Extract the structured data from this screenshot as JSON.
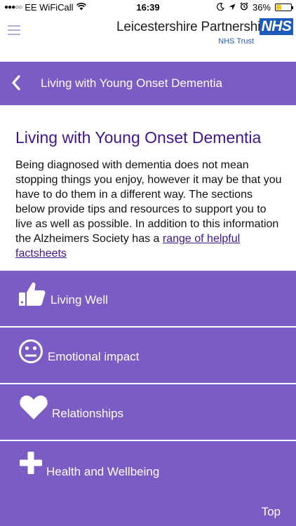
{
  "status_bar": {
    "carrier": "EE WiFiCall",
    "time": "16:39",
    "battery": "36%",
    "battery_level": 0.36
  },
  "header": {
    "org_name": "Leicestershire Partnership",
    "nhs_logo": "NHS",
    "org_sub": "NHS Trust",
    "menu_icon": "hamburger-icon"
  },
  "title_bar": {
    "back_icon": "chevron-left-icon",
    "title": "Living with Young Onset Dementia"
  },
  "content": {
    "heading": "Living with Young Onset Dementia",
    "intro": "Being diagnosed with dementia does not mean stopping things you enjoy, however it may be that you have to do them in a different way. The sections below provide tips and resources to support you to live as well as possible. In addition to this information the Alzheimers Society has a ",
    "link_text": "range of helpful factsheets"
  },
  "menu": [
    {
      "label": "Living Well",
      "icon": "thumbs-up-icon"
    },
    {
      "label": "Emotional impact",
      "icon": "neutral-face-icon"
    },
    {
      "label": "Relationships",
      "icon": "heart-icon"
    },
    {
      "label": "Health and Wellbeing",
      "icon": "plus-icon"
    }
  ],
  "footer": {
    "top_label": "Top"
  },
  "colors": {
    "brand_purple": "#7b5cc4",
    "heading_purple": "#3d1690",
    "nhs_blue": "#1e5bb8"
  }
}
